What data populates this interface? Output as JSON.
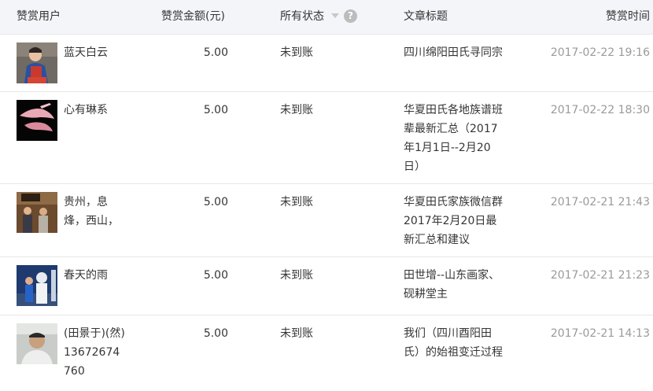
{
  "header": {
    "user": "赞赏用户",
    "amount": "赞赏金额(元)",
    "status": "所有状态",
    "help": "?",
    "title": "文章标题",
    "time": "赞赏时间"
  },
  "rows": [
    {
      "user": "蓝天白云",
      "amount": "5.00",
      "status": "未到账",
      "title": "四川绵阳田氏寻同宗",
      "time": "2017-02-22 19:16"
    },
    {
      "user": "心有琳系",
      "amount": "5.00",
      "status": "未到账",
      "title": "华夏田氏各地族谱班辈最新汇总（2017年1月1日--2月20日）",
      "time": "2017-02-22 18:30"
    },
    {
      "user": "贵州，息烽，西山，",
      "amount": "5.00",
      "status": "未到账",
      "title": "华夏田氏家族微信群2017年2月20日最新汇总和建议",
      "time": "2017-02-21 21:43"
    },
    {
      "user": "春天的雨",
      "amount": "5.00",
      "status": "未到账",
      "title": "田世增--山东画家、砚耕堂主",
      "time": "2017-02-21 21:23"
    },
    {
      "user": "(田景于)(然)13672674760",
      "amount": "5.00",
      "status": "未到账",
      "title": "我们（四川酉阳田氏）的始祖变迁过程",
      "time": "2017-02-21 14:13"
    }
  ]
}
